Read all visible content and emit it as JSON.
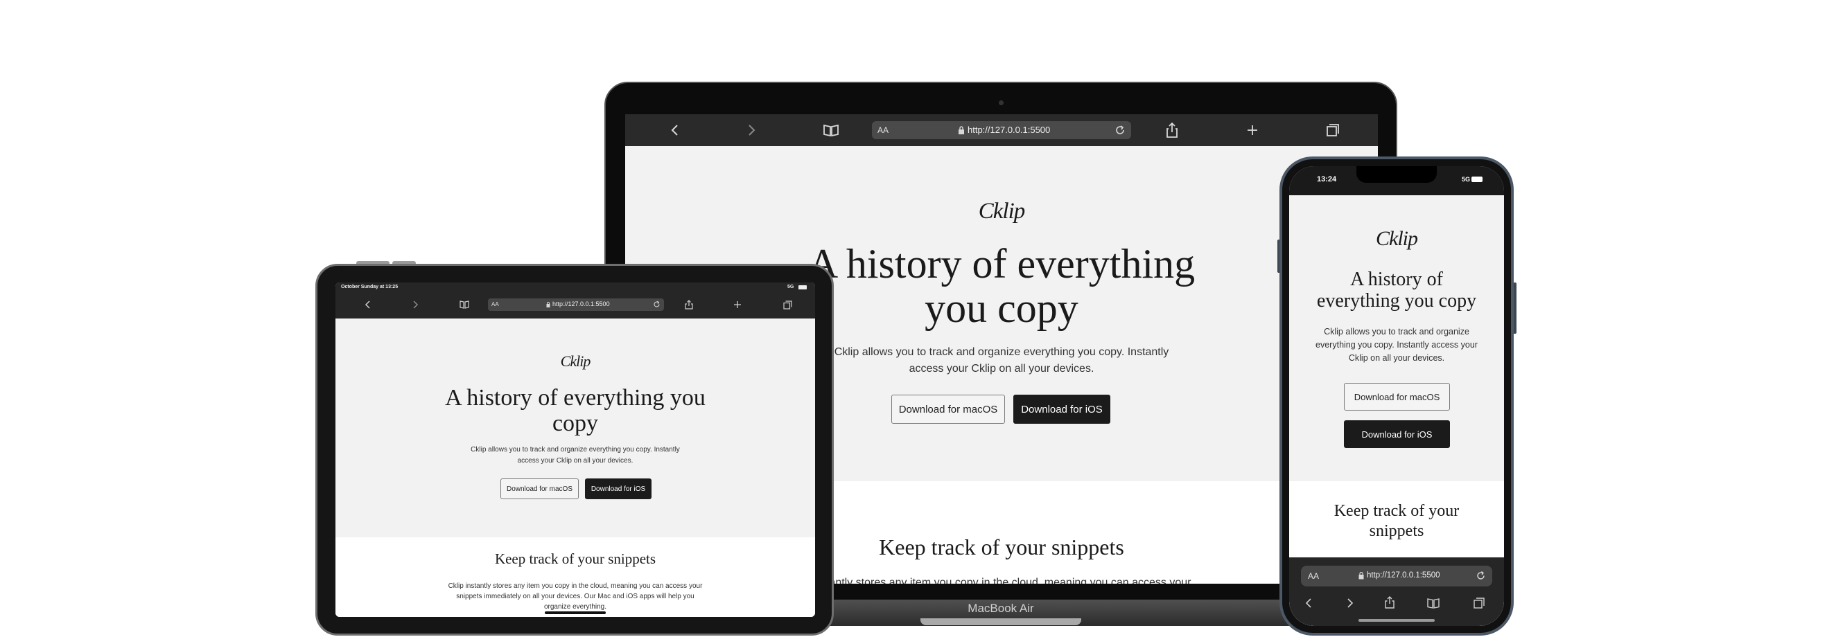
{
  "macbook": {
    "label": "MacBook Air",
    "toolbar": {
      "text_size": "AA",
      "url": "http://127.0.0.1:5500"
    },
    "page": {
      "logo": "Cklip",
      "headline_line1": "A history of everything",
      "headline_line2": "you copy",
      "subtitle_line1": "Cklip allows you to track and organize everything you copy. Instantly",
      "subtitle_line2": "access your Cklip on all your devices.",
      "btn_macos": "Download for macOS",
      "btn_ios": "Download for iOS",
      "section_title": "Keep track of your snippets",
      "section_text_partial": "instantly stores any item you copy in the cloud, meaning you can access your"
    }
  },
  "ipad": {
    "status_time": "October Sunday at 13:25",
    "status_right": "5G",
    "toolbar": {
      "text_size": "AA",
      "url": "http://127.0.0.1:5500"
    },
    "page": {
      "logo": "Cklip",
      "headline_line1": "A history of everything you",
      "headline_line2": "copy",
      "subtitle_line1": "Cklip allows you to track and organize everything you copy. Instantly",
      "subtitle_line2": "access your Cklip on all your devices.",
      "btn_macos": "Download for macOS",
      "btn_ios": "Download for iOS",
      "section_title": "Keep track of your snippets",
      "section_line1": "Cklip instantly stores any item you copy in the cloud, meaning you can access your",
      "section_line2": "snippets immediately on all your devices. Our Mac and iOS apps will help you",
      "section_line3": "organize everything."
    }
  },
  "iphone": {
    "status_time": "13:24",
    "status_right": "5G",
    "page": {
      "logo": "Cklip",
      "headline_line1": "A history of",
      "headline_line2": "everything you copy",
      "subtitle_line1": "Cklip allows you to track and organize",
      "subtitle_line2": "everything you copy. Instantly access your",
      "subtitle_line3": "Cklip on all your devices.",
      "btn_macos": "Download for macOS",
      "btn_ios": "Download for iOS",
      "section_title_line1": "Keep track of your",
      "section_title_line2": "snippets"
    },
    "toolbar": {
      "text_size": "AA",
      "url": "http://127.0.0.1:5500"
    }
  }
}
